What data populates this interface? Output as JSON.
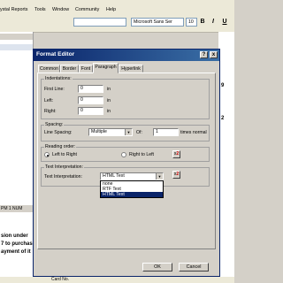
{
  "app": {
    "menu": [
      "ystal Reports",
      "Tools",
      "Window",
      "Community",
      "Help"
    ],
    "font_name": "Microsoft Sans Ser",
    "font_size": "10",
    "bold": "B",
    "italic": "I",
    "underline": "U",
    "left_panel_status": "PM 1 NUM",
    "report_fragments": [
      "sion under",
      "7 to purchas",
      "ayment of it"
    ],
    "bottom_text": "Card No.",
    "number_marks": [
      "9",
      "2"
    ]
  },
  "dialog": {
    "title": "Format Editor",
    "help_label": "?",
    "close_label": "x",
    "tabs": [
      "Common",
      "Border",
      "Font",
      "Paragraph",
      "Hyperlink"
    ],
    "active_tab": "Paragraph",
    "indentations": {
      "legend": "Indentations:",
      "first_line_label": "First Line:",
      "first_line_value": "0",
      "left_label": "Left:",
      "left_value": "0",
      "right_label": "Right:",
      "right_value": "0",
      "unit": "in"
    },
    "spacing": {
      "legend": "Spacing:",
      "line_spacing_label": "Line Spacing:",
      "line_spacing_value": "Multiple",
      "of_label": "Of:",
      "of_value": "1",
      "of_unit": "times normal"
    },
    "reading_order": {
      "legend": "Reading order:",
      "ltr_label": "Left to Right",
      "rtl_label": "Right to Left",
      "selected": "Left to Right"
    },
    "text_interpretation": {
      "legend": "Text Interpretation:",
      "label": "Text Interpretation:",
      "value": "HTML Text",
      "options": [
        "none",
        "RTF Text",
        "HTML Text"
      ],
      "highlighted": "HTML Text"
    },
    "formula_button_label": "x-2",
    "buttons": {
      "ok": "OK",
      "cancel": "Cancel"
    }
  }
}
